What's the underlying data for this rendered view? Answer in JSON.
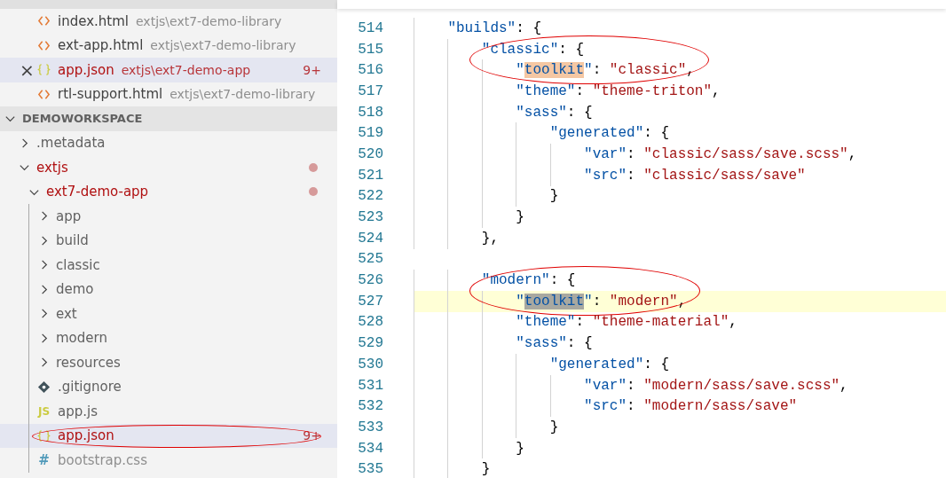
{
  "open_editors": [
    {
      "kind": "html",
      "name": "index.html",
      "path": "extjs\\ext7-demo-library",
      "selected": false,
      "errors": false
    },
    {
      "kind": "html",
      "name": "ext-app.html",
      "path": "extjs\\ext7-demo-library",
      "selected": false,
      "errors": false
    },
    {
      "kind": "json",
      "name": "app.json",
      "path": "extjs\\ext7-demo-app",
      "selected": true,
      "errors": true,
      "close": "×",
      "badge": "9+"
    },
    {
      "kind": "html",
      "name": "rtl-support.html",
      "path": "extjs\\ext7-demo-library",
      "selected": false,
      "errors": false
    }
  ],
  "workspace": {
    "title": "DEMOWORKSPACE",
    "expanded": true,
    "items": [
      {
        "kind": "folder",
        "name": ".metadata",
        "expanded": false,
        "modified": false
      },
      {
        "kind": "folder",
        "name": "extjs",
        "expanded": true,
        "modified": true,
        "children": [
          {
            "kind": "folder",
            "name": "ext7-demo-app",
            "expanded": true,
            "modified": true,
            "children": [
              {
                "kind": "folder",
                "name": "app",
                "expanded": false,
                "modified": false
              },
              {
                "kind": "folder",
                "name": "build",
                "expanded": false,
                "modified": false
              },
              {
                "kind": "folder",
                "name": "classic",
                "expanded": false,
                "modified": false
              },
              {
                "kind": "folder",
                "name": "demo",
                "expanded": false,
                "modified": false
              },
              {
                "kind": "folder",
                "name": "ext",
                "expanded": false,
                "modified": false
              },
              {
                "kind": "folder",
                "name": "modern",
                "expanded": false,
                "modified": false
              },
              {
                "kind": "folder",
                "name": "resources",
                "expanded": false,
                "modified": false
              },
              {
                "kind": "git",
                "name": ".gitignore",
                "modified": false
              },
              {
                "kind": "js",
                "name": "app.js",
                "modified": false,
                "icon_text": "JS"
              },
              {
                "kind": "json",
                "name": "app.json",
                "modified": false,
                "selected": true,
                "errors": true,
                "badge": "9+",
                "circled": true
              },
              {
                "kind": "css",
                "name": "bootstrap.css",
                "modified": false,
                "icon_text": "#"
              }
            ]
          }
        ]
      }
    ]
  },
  "editor": {
    "lines": [
      {
        "number": "514",
        "current": false,
        "circled": false,
        "tokens": [
          {
            "kind": "key",
            "text": "    \"builds\""
          },
          {
            "kind": "punct",
            "text": ": {"
          }
        ]
      },
      {
        "number": "515",
        "current": false,
        "circled": true,
        "tokens": [
          {
            "kind": "key",
            "text": "        \"classic\""
          },
          {
            "kind": "punct",
            "text": ": {"
          }
        ]
      },
      {
        "number": "516",
        "current": false,
        "circled": true,
        "tokens": [
          {
            "kind": "key",
            "text": "            \""
          },
          {
            "kind": "match",
            "text": "toolkit"
          },
          {
            "kind": "key",
            "text": "\""
          },
          {
            "kind": "punct",
            "text": ": "
          },
          {
            "kind": "string",
            "text": "\"classic\""
          },
          {
            "kind": "punct",
            "text": ","
          }
        ]
      },
      {
        "number": "517",
        "current": false,
        "circled": false,
        "tokens": [
          {
            "kind": "key",
            "text": "            \"theme\""
          },
          {
            "kind": "punct",
            "text": ": "
          },
          {
            "kind": "string",
            "text": "\"theme-triton\""
          },
          {
            "kind": "punct",
            "text": ","
          }
        ]
      },
      {
        "number": "518",
        "current": false,
        "circled": false,
        "tokens": [
          {
            "kind": "key",
            "text": "            \"sass\""
          },
          {
            "kind": "punct",
            "text": ": {"
          }
        ]
      },
      {
        "number": "519",
        "current": false,
        "circled": false,
        "tokens": [
          {
            "kind": "key",
            "text": "                \"generated\""
          },
          {
            "kind": "punct",
            "text": ": {"
          }
        ]
      },
      {
        "number": "520",
        "current": false,
        "circled": false,
        "tokens": [
          {
            "kind": "key",
            "text": "                    \"var\""
          },
          {
            "kind": "punct",
            "text": ": "
          },
          {
            "kind": "string",
            "text": "\"classic/sass/save.scss\""
          },
          {
            "kind": "punct",
            "text": ","
          }
        ]
      },
      {
        "number": "521",
        "current": false,
        "circled": false,
        "tokens": [
          {
            "kind": "key",
            "text": "                    \"src\""
          },
          {
            "kind": "punct",
            "text": ": "
          },
          {
            "kind": "string",
            "text": "\"classic/sass/save\""
          }
        ]
      },
      {
        "number": "522",
        "current": false,
        "circled": false,
        "tokens": [
          {
            "kind": "punct",
            "text": "                }"
          }
        ]
      },
      {
        "number": "523",
        "current": false,
        "circled": false,
        "tokens": [
          {
            "kind": "punct",
            "text": "            }"
          }
        ]
      },
      {
        "number": "524",
        "current": false,
        "circled": false,
        "tokens": [
          {
            "kind": "punct",
            "text": "        },"
          }
        ]
      },
      {
        "number": "525",
        "current": false,
        "circled": false
      },
      {
        "number": "526",
        "current": false,
        "circled": true,
        "tokens": [
          {
            "kind": "key",
            "text": "        \"modern\""
          },
          {
            "kind": "punct",
            "text": ": {"
          }
        ]
      },
      {
        "number": "527",
        "current": true,
        "circled": true,
        "tokens": [
          {
            "kind": "key",
            "text": "            \""
          },
          {
            "kind": "selection",
            "text": "toolkit"
          },
          {
            "kind": "key",
            "text": "\""
          },
          {
            "kind": "punct",
            "text": ": "
          },
          {
            "kind": "string",
            "text": "\"modern\""
          },
          {
            "kind": "punct",
            "text": ","
          }
        ]
      },
      {
        "number": "528",
        "current": false,
        "circled": false,
        "tokens": [
          {
            "kind": "key",
            "text": "            \"theme\""
          },
          {
            "kind": "punct",
            "text": ": "
          },
          {
            "kind": "string",
            "text": "\"theme-material\""
          },
          {
            "kind": "punct",
            "text": ","
          }
        ]
      },
      {
        "number": "529",
        "current": false,
        "circled": false,
        "tokens": [
          {
            "kind": "key",
            "text": "            \"sass\""
          },
          {
            "kind": "punct",
            "text": ": {"
          }
        ]
      },
      {
        "number": "530",
        "current": false,
        "circled": false,
        "tokens": [
          {
            "kind": "key",
            "text": "                \"generated\""
          },
          {
            "kind": "punct",
            "text": ": {"
          }
        ]
      },
      {
        "number": "531",
        "current": false,
        "circled": false,
        "tokens": [
          {
            "kind": "key",
            "text": "                    \"var\""
          },
          {
            "kind": "punct",
            "text": ": "
          },
          {
            "kind": "string",
            "text": "\"modern/sass/save.scss\""
          },
          {
            "kind": "punct",
            "text": ","
          }
        ]
      },
      {
        "number": "532",
        "current": false,
        "circled": false,
        "tokens": [
          {
            "kind": "key",
            "text": "                    \"src\""
          },
          {
            "kind": "punct",
            "text": ": "
          },
          {
            "kind": "string",
            "text": "\"modern/sass/save\""
          }
        ]
      },
      {
        "number": "533",
        "current": false,
        "circled": false,
        "tokens": [
          {
            "kind": "punct",
            "text": "                }"
          }
        ]
      },
      {
        "number": "534",
        "current": false,
        "circled": false,
        "tokens": [
          {
            "kind": "punct",
            "text": "            }"
          }
        ]
      },
      {
        "number": "535",
        "current": false,
        "circled": false,
        "tokens": [
          {
            "kind": "punct",
            "text": "        }"
          }
        ]
      }
    ]
  }
}
